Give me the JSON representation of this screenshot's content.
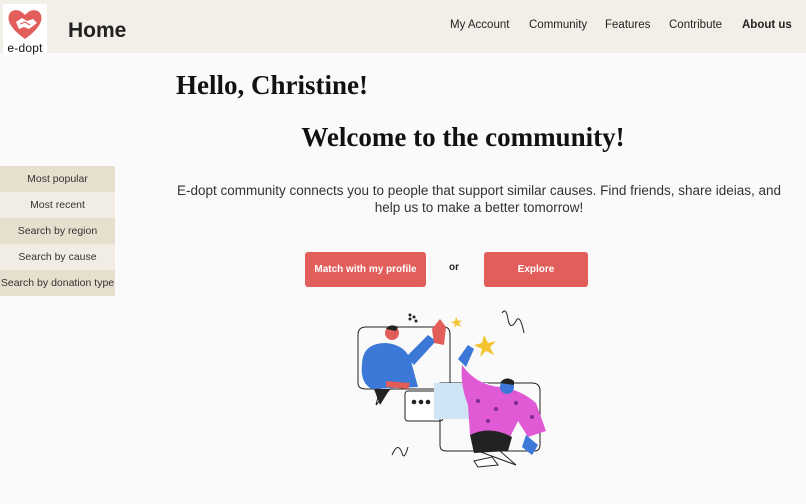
{
  "brand": {
    "logo_text": "e-dopt",
    "accent": "#e25e5b"
  },
  "header": {
    "title": "Home"
  },
  "nav": {
    "items": [
      {
        "label": "My Account"
      },
      {
        "label": "Community"
      },
      {
        "label": "Features"
      },
      {
        "label": "Contribute"
      },
      {
        "label": "About us",
        "active": true
      }
    ]
  },
  "main": {
    "greeting": "Hello, Christine!",
    "welcome": "Welcome to the community!",
    "description": "E-dopt community connects you to people that support similar causes. Find friends, share ideias, and help us to make a better tomorrow!",
    "match_button": "Match with my profile",
    "or_text": "or",
    "explore_button": "Explore"
  },
  "sidebar": {
    "items": [
      {
        "label": "Most popular"
      },
      {
        "label": "Most recent"
      },
      {
        "label": "Search by region"
      },
      {
        "label": "Search by cause"
      },
      {
        "label": "Search by donation type"
      }
    ]
  },
  "illustration": {
    "icon": "high-five-illustration"
  }
}
